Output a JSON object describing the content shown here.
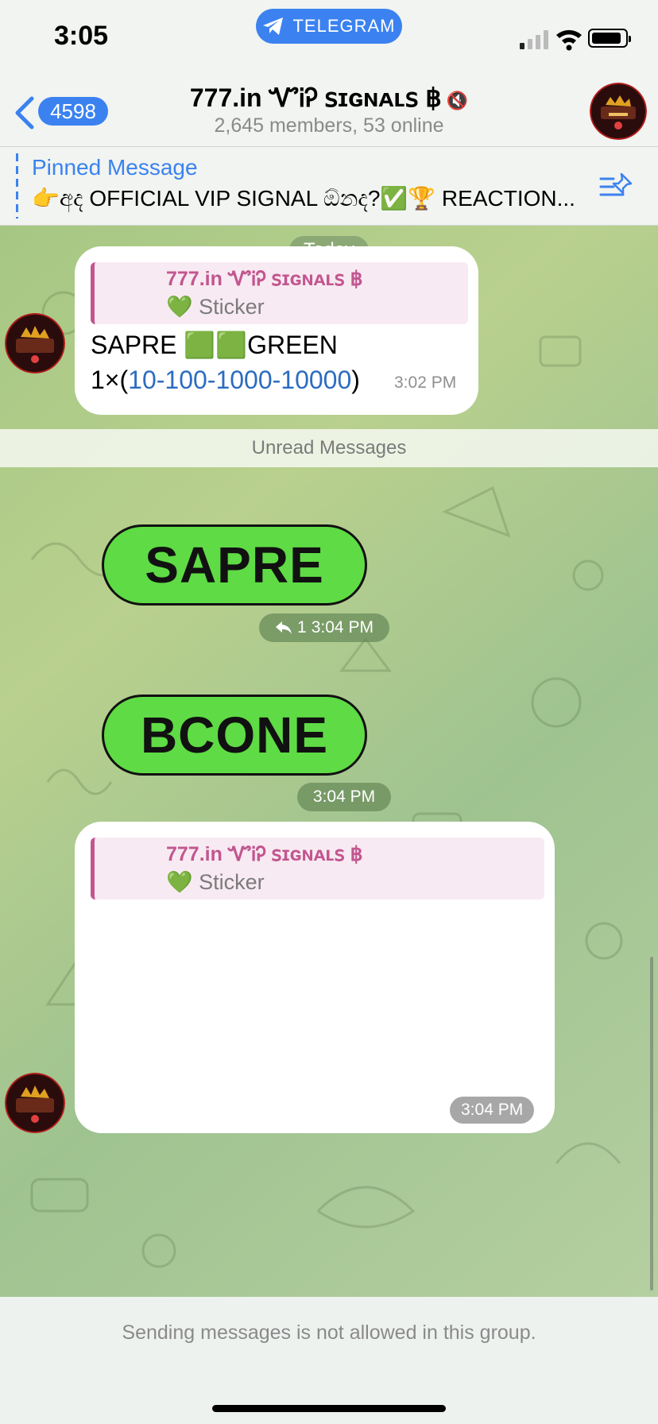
{
  "status_bar": {
    "time": "3:05",
    "pill_label": "TELEGRAM"
  },
  "header": {
    "unread_count": "4598",
    "title": "777.in ᏉᎥᎮ ꜱɪɢɴᴀʟꜱ ฿",
    "subtitle": "2,645 members, 53 online"
  },
  "pinned": {
    "title": "Pinned Message",
    "text": "👉අද OFFICIAL VIP SIGNAL ඕනද?✅🏆 REACTION..."
  },
  "chat": {
    "date_label": "Today",
    "message1": {
      "quote_name": "777.in ᏉᎥᎮ ꜱɪɢɴᴀʟꜱ ฿",
      "quote_sub": "💚 Sticker",
      "line1": "SAPRE 🟩🟩GREEN",
      "line2_prefix": "1×(",
      "line2_link": "10-100-1000-10000",
      "line2_suffix": ")",
      "time": "3:02 PM"
    },
    "unread_label": "Unread Messages",
    "sticker1": {
      "text": "SAPRE",
      "reply_count": "1",
      "time": "3:04 PM"
    },
    "sticker2": {
      "text": "BCONE",
      "time": "3:04 PM"
    },
    "message2": {
      "quote_name": "777.in ᏉᎥᎮ ꜱɪɢɴᴀʟꜱ ฿",
      "quote_sub": "💚 Sticker",
      "time": "3:04 PM"
    }
  },
  "footer": {
    "text": "Sending messages is not allowed in this group."
  },
  "colors": {
    "accent": "#3b82f0",
    "quote_accent": "#c2568f",
    "sticker_green": "#5fdb45"
  },
  "icons": [
    "telegram-icon",
    "signal-icon",
    "wifi-icon",
    "battery-icon",
    "back-chevron-icon",
    "mute-icon",
    "pin-list-icon",
    "reply-icon"
  ]
}
